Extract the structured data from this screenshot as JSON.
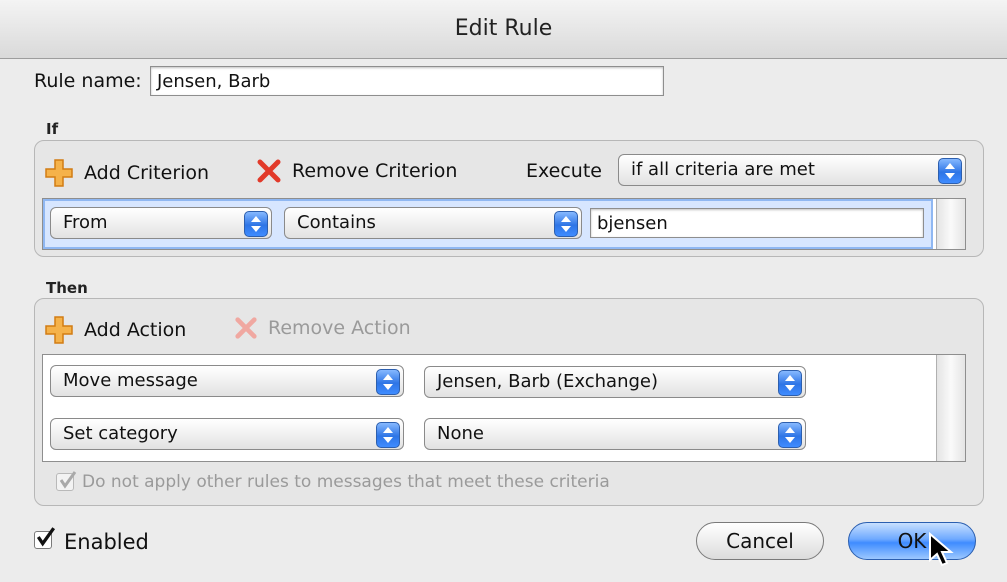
{
  "window": {
    "title": "Edit Rule"
  },
  "rule": {
    "name_label": "Rule name:",
    "name_value": "Jensen, Barb"
  },
  "if_section": {
    "title": "If",
    "add_label": "Add Criterion",
    "remove_label": "Remove Criterion",
    "execute_label": "Execute",
    "execute_value": "if all criteria are met",
    "criteria": [
      {
        "field": "From",
        "operator": "Contains",
        "value": "bjensen"
      }
    ]
  },
  "then_section": {
    "title": "Then",
    "add_label": "Add Action",
    "remove_label": "Remove Action",
    "actions": [
      {
        "action": "Move message",
        "target": "Jensen, Barb (Exchange)"
      },
      {
        "action": "Set category",
        "target": "None"
      }
    ],
    "stop_rules_label": "Do not apply other rules to messages that meet these criteria",
    "stop_rules_checked": true
  },
  "footer": {
    "enabled_label": "Enabled",
    "enabled_checked": true,
    "cancel_label": "Cancel",
    "ok_label": "OK"
  },
  "colors": {
    "accent": "#3f8cff",
    "plus_icon": "#f2a23a",
    "remove_icon": "#e23a2a"
  }
}
